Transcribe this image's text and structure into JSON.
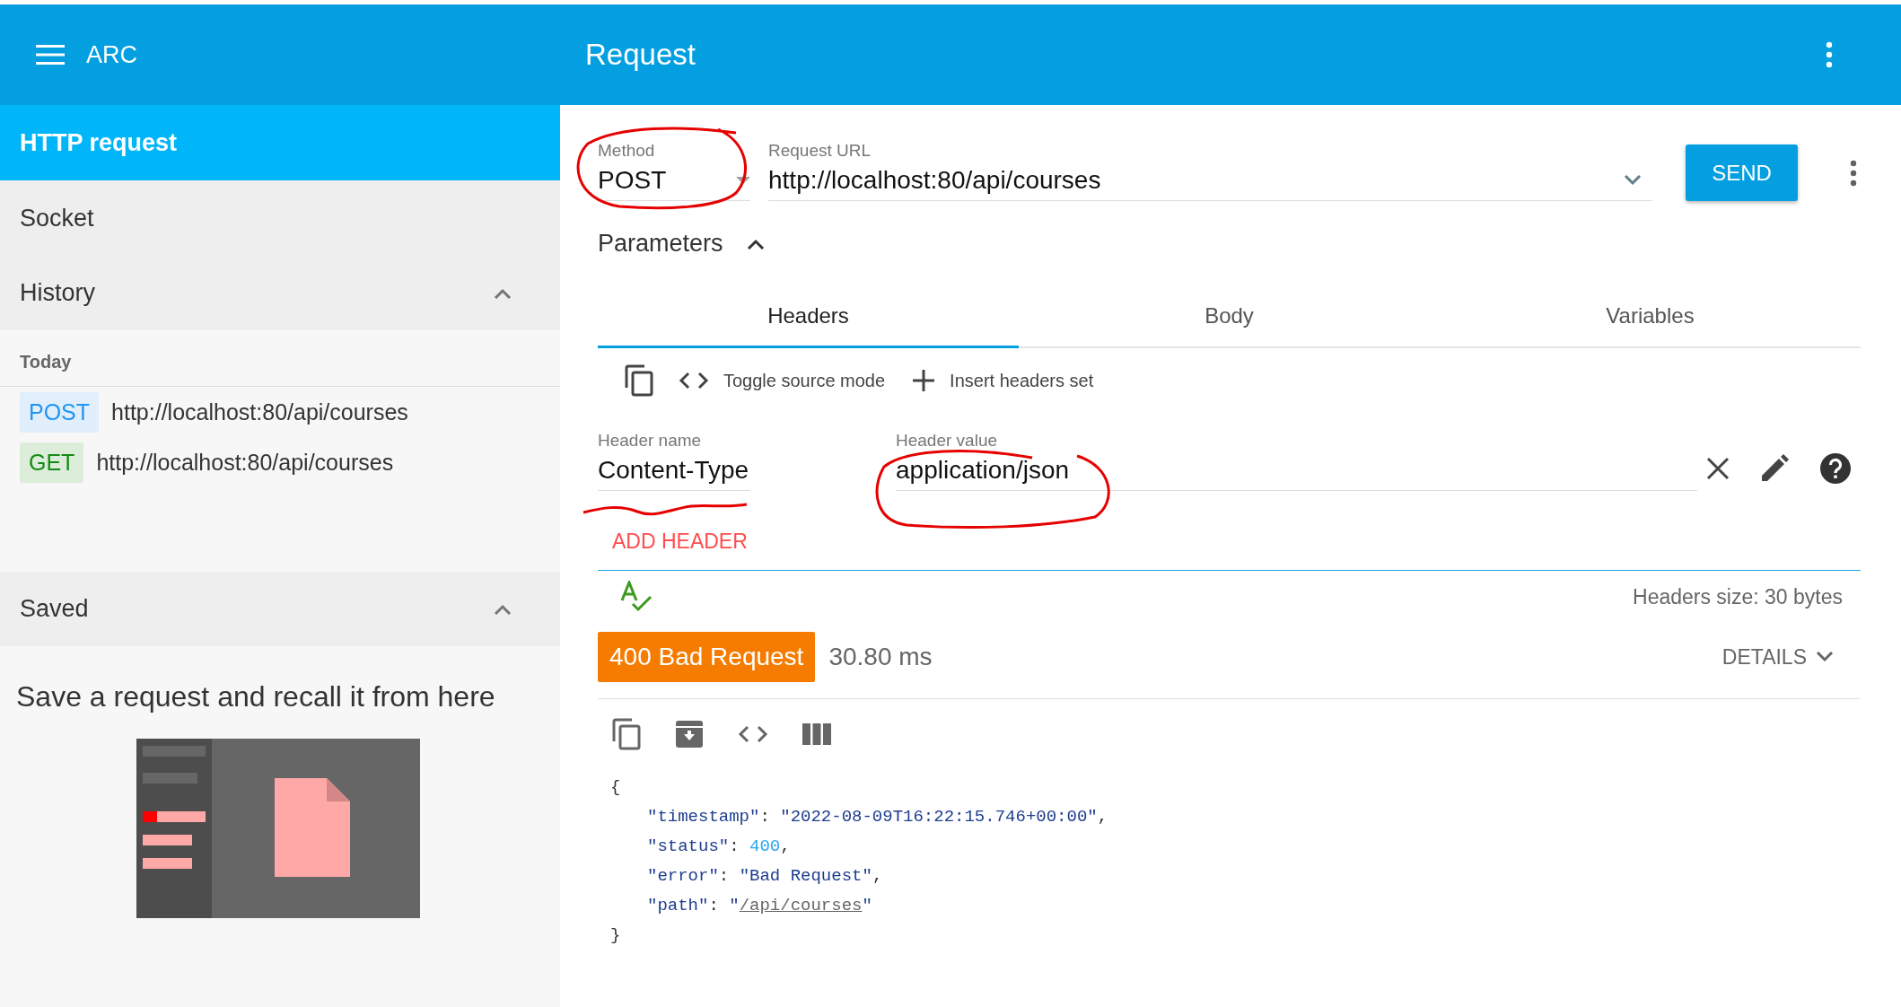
{
  "app_bar": {
    "app_name": "ARC",
    "title": "Request"
  },
  "sidebar": {
    "items": [
      {
        "label": "HTTP request",
        "selected": true
      },
      {
        "label": "Socket",
        "selected": false
      }
    ],
    "history": {
      "title": "History",
      "expanded": true,
      "groups": [
        {
          "label": "Today",
          "entries": [
            {
              "method": "POST",
              "kind": "post",
              "url": "http://localhost:80/api/courses"
            },
            {
              "method": "GET",
              "kind": "get",
              "url": "http://localhost:80/api/courses"
            }
          ]
        }
      ]
    },
    "saved": {
      "title": "Saved",
      "expanded": true,
      "empty_message": "Save a request and recall it from here"
    }
  },
  "request": {
    "method": {
      "label": "Method",
      "value": "POST"
    },
    "url": {
      "label": "Request URL",
      "value": "http://localhost:80/api/courses"
    },
    "send_button": "SEND",
    "parameters": {
      "label": "Parameters",
      "expanded": true
    },
    "tabs": [
      {
        "label": "Headers",
        "selected": true
      },
      {
        "label": "Body",
        "selected": false
      },
      {
        "label": "Variables",
        "selected": false
      }
    ],
    "header_tools": [
      "Toggle source mode",
      "Insert headers set"
    ],
    "headers": [
      {
        "name_label": "Header name",
        "name": "Content-Type",
        "value_label": "Header value",
        "value": "application/json"
      }
    ],
    "add_header": "ADD HEADER",
    "headers_size": "Headers size: 30 bytes"
  },
  "response": {
    "status": "400 Bad Request",
    "time": "30.80 ms",
    "details": "DETAILS",
    "body": [
      [
        {
          "kind": "punct",
          "text": "{"
        }
      ],
      [
        {
          "kind": "key",
          "text": "\"timestamp\""
        },
        {
          "kind": "punct",
          "text": ": "
        },
        {
          "kind": "string",
          "text": "\"2022-08-09T16:22:15.746+00:00\""
        },
        {
          "kind": "punct",
          "text": ","
        }
      ],
      [
        {
          "kind": "key",
          "text": "\"status\""
        },
        {
          "kind": "punct",
          "text": ": "
        },
        {
          "kind": "number",
          "text": "400"
        },
        {
          "kind": "punct",
          "text": ","
        }
      ],
      [
        {
          "kind": "key",
          "text": "\"error\""
        },
        {
          "kind": "punct",
          "text": ": "
        },
        {
          "kind": "string",
          "text": "\"Bad Request\""
        },
        {
          "kind": "punct",
          "text": ","
        }
      ],
      [
        {
          "kind": "key",
          "text": "\"path\""
        },
        {
          "kind": "punct",
          "text": ": "
        },
        {
          "kind": "string",
          "text": "\""
        },
        {
          "kind": "link",
          "text": "/api/courses"
        },
        {
          "kind": "string",
          "text": "\""
        }
      ],
      [
        {
          "kind": "punct",
          "text": "}"
        }
      ]
    ]
  }
}
